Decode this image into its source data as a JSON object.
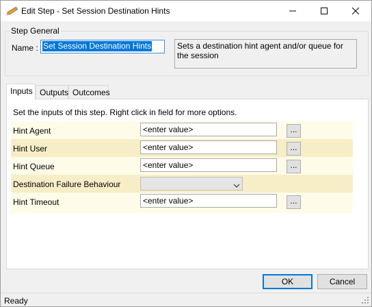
{
  "window": {
    "title": "Edit Step - Set Session Destination Hints",
    "icon": "pencil-icon"
  },
  "step_general": {
    "group_title": "Step General",
    "name_label": "Name :",
    "name_value": "Set Session Destination Hints",
    "description": "Sets a destination hint agent and/or queue for the session"
  },
  "tabs": [
    {
      "label": "Inputs",
      "active": true
    },
    {
      "label": "Outputs",
      "active": false
    },
    {
      "label": "Outcomes",
      "active": false
    }
  ],
  "inputs_panel": {
    "hint": "Set the inputs of this step.  Right click in field for more options.",
    "rows": [
      {
        "label": "Hint Agent",
        "value": "<enter value>",
        "button": "..."
      },
      {
        "label": "Hint User",
        "value": "<enter value>",
        "button": "..."
      },
      {
        "label": "Hint Queue",
        "value": "<enter value>",
        "button": "..."
      },
      {
        "label": "Destination Failure Behaviour",
        "value": ""
      },
      {
        "label": "Hint Timeout",
        "value": "<enter value>",
        "button": "..."
      }
    ]
  },
  "buttons": {
    "ok": "OK",
    "cancel": "Cancel"
  },
  "status": {
    "text": "Ready"
  },
  "colors": {
    "row_light": "#fefce8",
    "row_dark": "#f7eec7",
    "selection": "#0078d7"
  }
}
